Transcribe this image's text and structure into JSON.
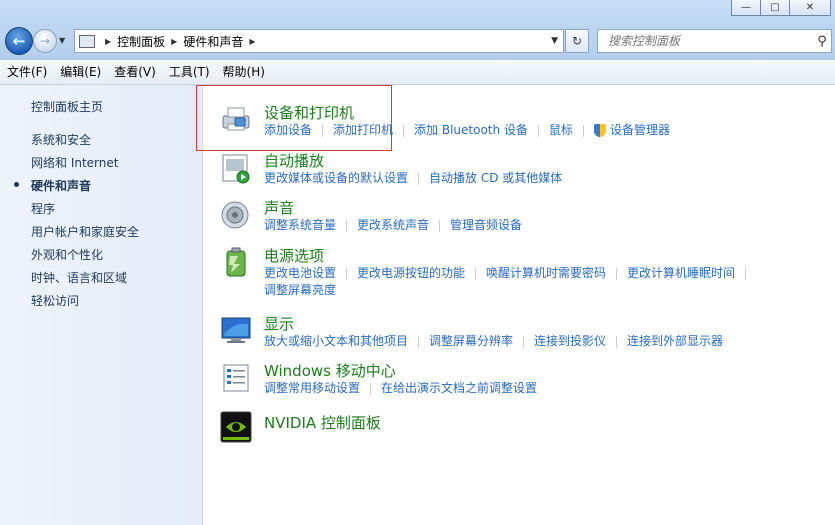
{
  "window": {
    "buttons": [
      "minimize",
      "maximize",
      "close"
    ]
  },
  "address": {
    "crumbs": [
      "控制面板",
      "硬件和声音"
    ]
  },
  "search": {
    "placeholder": "搜索控制面板"
  },
  "menu": [
    "文件(F)",
    "编辑(E)",
    "查看(V)",
    "工具(T)",
    "帮助(H)"
  ],
  "sidebar": {
    "home": "控制面板主页",
    "items": [
      "系统和安全",
      "网络和 Internet",
      "硬件和声音",
      "程序",
      "用户帐户和家庭安全",
      "外观和个性化",
      "时钟、语言和区域",
      "轻松访问"
    ],
    "active_index": 2
  },
  "categories": [
    {
      "title": "设备和打印机",
      "icon": "printer-icon",
      "links": [
        [
          "添加设备",
          "添加打印机",
          "添加 Bluetooth 设备",
          "鼠标",
          "设备管理器"
        ]
      ]
    },
    {
      "title": "自动播放",
      "icon": "autoplay-icon",
      "links": [
        [
          "更改媒体或设备的默认设置",
          "自动播放 CD 或其他媒体"
        ]
      ]
    },
    {
      "title": "声音",
      "icon": "speaker-icon",
      "links": [
        [
          "调整系统音量",
          "更改系统声音",
          "管理音频设备"
        ]
      ]
    },
    {
      "title": "电源选项",
      "icon": "battery-icon",
      "links": [
        [
          "更改电池设置",
          "更改电源按钮的功能",
          "唤醒计算机时需要密码",
          "更改计算机睡眠时间"
        ],
        [
          "调整屏幕亮度"
        ]
      ]
    },
    {
      "title": "显示",
      "icon": "monitor-icon",
      "links": [
        [
          "放大或缩小文本和其他项目",
          "调整屏幕分辨率",
          "连接到投影仪",
          "连接到外部显示器"
        ]
      ]
    },
    {
      "title": "Windows 移动中心",
      "icon": "mobility-center-icon",
      "links": [
        [
          "调整常用移动设置",
          "在给出演示文档之前调整设置"
        ]
      ]
    },
    {
      "title": "NVIDIA 控制面板",
      "icon": "nvidia-icon",
      "links": []
    }
  ]
}
